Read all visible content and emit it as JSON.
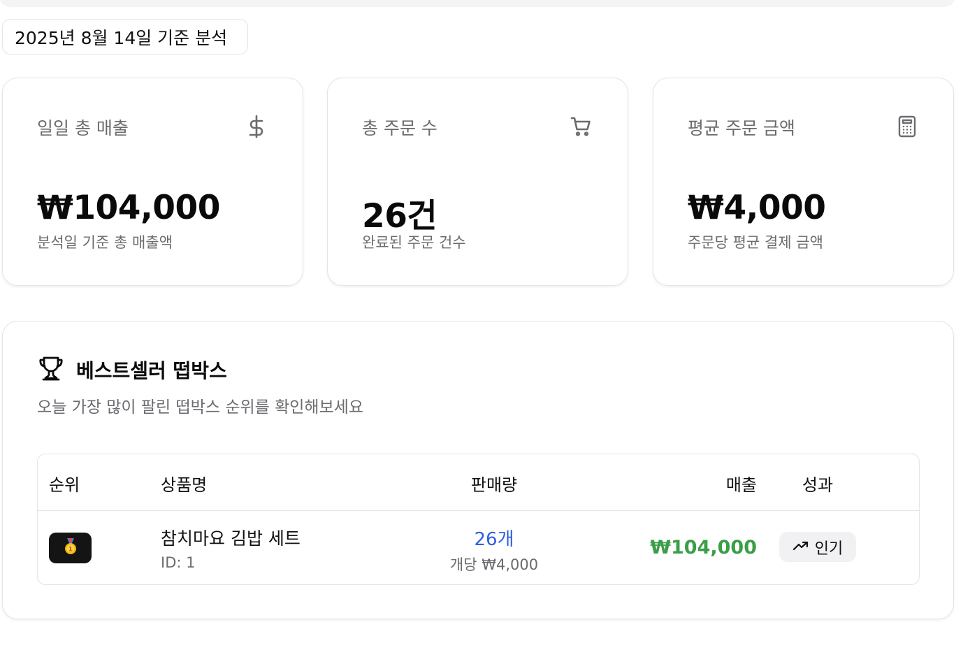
{
  "date_badge": "2025년 8월 14일 기준 분석",
  "cards": [
    {
      "title": "일일 총 매출",
      "icon": "dollar-icon",
      "value": "₩104,000",
      "sub": "분석일 기준 총 매출액"
    },
    {
      "title": "총 주문 수",
      "icon": "cart-icon",
      "value": "26건",
      "sub": "완료된 주문 건수"
    },
    {
      "title": "평균 주문 금액",
      "icon": "calculator-icon",
      "value": "₩4,000",
      "sub": "주문당 평균 결제 금액"
    }
  ],
  "bestseller": {
    "icon": "trophy-icon",
    "title": "베스트셀러 떱박스",
    "description": "오늘 가장 많이 팔린 떱박스 순위를 확인해보세요",
    "columns": {
      "rank": "순위",
      "product": "상품명",
      "quantity": "판매량",
      "revenue": "매출",
      "performance": "성과"
    },
    "rows": [
      {
        "rank_icon": "gold-medal-icon",
        "product_name": "참치마요 김밥 세트",
        "product_id": "ID: 1",
        "quantity": "26개",
        "unit_price": "개당 ₩4,000",
        "revenue": "₩104,000",
        "performance": "인기",
        "performance_icon": "trending-up-icon"
      }
    ]
  },
  "colors": {
    "quantity": "#2f5ee0",
    "revenue": "#3a9e47",
    "muted_text": "#6b6b70",
    "border": "#e4e4e7",
    "rank_badge": "#141414"
  }
}
